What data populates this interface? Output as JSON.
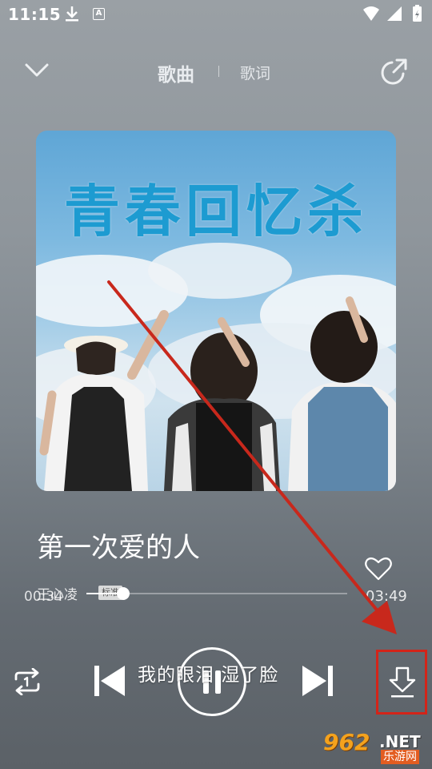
{
  "status_bar": {
    "time": "11:15",
    "notif_a_icon": "A"
  },
  "header": {
    "tab_song": "歌曲",
    "tab_lyrics": "歌词"
  },
  "cover": {
    "title_text": "青春回忆杀"
  },
  "song": {
    "title": "第一次爱的人",
    "artist": "王心凌",
    "badge": "标准"
  },
  "progress": {
    "current": "00:34",
    "total": "03:49",
    "fraction": 0.14
  },
  "lyrics": {
    "current_line": "我的眼泪 湿了脸"
  },
  "watermark": {
    "num": "962",
    "net": ".NET",
    "cn": "乐游网"
  },
  "icons": [
    "chevron-down-icon",
    "share-icon",
    "heart-icon",
    "repeat-one-icon",
    "previous-icon",
    "pause-icon",
    "next-icon",
    "download-icon"
  ],
  "colors": {
    "annotation": "#d32419",
    "cover_title": "#1d9bd1",
    "watermark_orange": "#f4a21d"
  }
}
